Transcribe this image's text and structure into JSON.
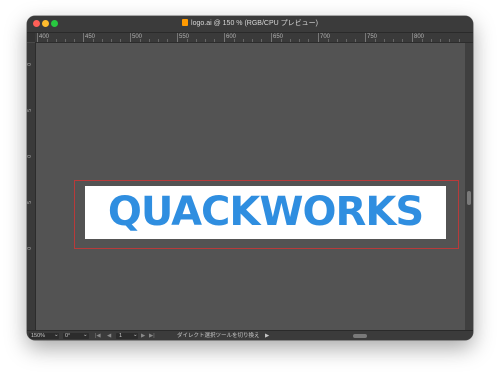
{
  "window": {
    "title": "logo.ai @ 150 % (RGB/CPU プレビュー)"
  },
  "ruler": {
    "top_ticks": [
      "400",
      "450",
      "500",
      "550",
      "600",
      "650",
      "700",
      "750",
      "800"
    ],
    "left_ticks": [
      "0",
      "5",
      "0",
      "5",
      "0"
    ]
  },
  "artboard": {
    "logo_text": "QUACKWORKS",
    "logo_color": "#2f8ee0",
    "outline_color": "#b93a3a"
  },
  "statusbar": {
    "zoom": "150%",
    "rotation": "0°",
    "artboard_number": "1",
    "status_text": "ダイレクト選択ツールを切り換え",
    "prev_glyph": "◀",
    "next_glyph": "▶",
    "first_glyph": "|◀",
    "last_glyph": "▶|",
    "play_glyph": "▶",
    "dropdown_glyph": "⌄"
  }
}
